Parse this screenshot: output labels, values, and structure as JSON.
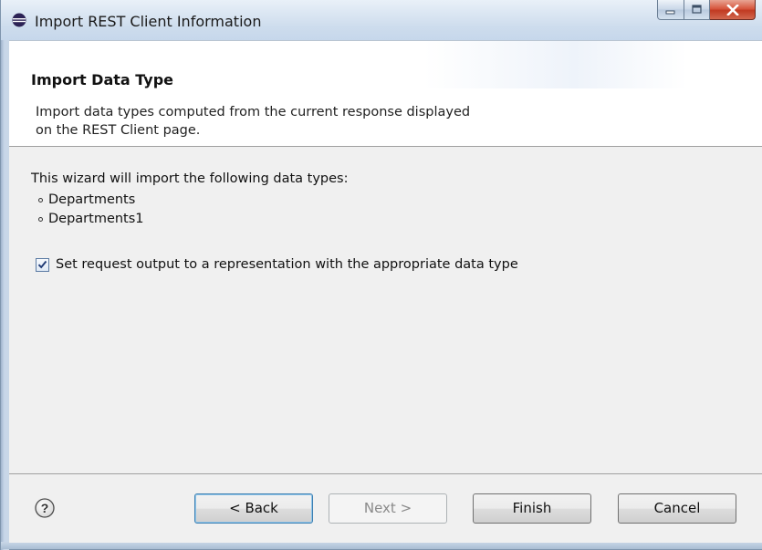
{
  "window": {
    "title": "Import REST Client Information",
    "title_icon": "eclipse-icon",
    "controls": [
      "minimize-icon",
      "maximize-icon",
      "close-icon"
    ]
  },
  "header": {
    "title": "Import Data Type",
    "description_line1": "Import data types computed from the current response displayed",
    "description_line2": "on the REST Client page."
  },
  "content": {
    "intro": "This wizard will import the following data types:",
    "data_types": [
      "Departments",
      "Departments1"
    ],
    "checkbox": {
      "label": "Set request output to a representation with the appropriate data type",
      "checked": true
    }
  },
  "footer": {
    "help_icon": "help-icon",
    "back_label": "< Back",
    "next_label": "Next >",
    "finish_label": "Finish",
    "cancel_label": "Cancel",
    "next_enabled": false,
    "default_button": "back"
  },
  "colors": {
    "titlebar": "#cddced",
    "close_button": "#c13a22",
    "default_button_border": "#3c7fb1",
    "checkbox_border": "#5c7ba3"
  }
}
